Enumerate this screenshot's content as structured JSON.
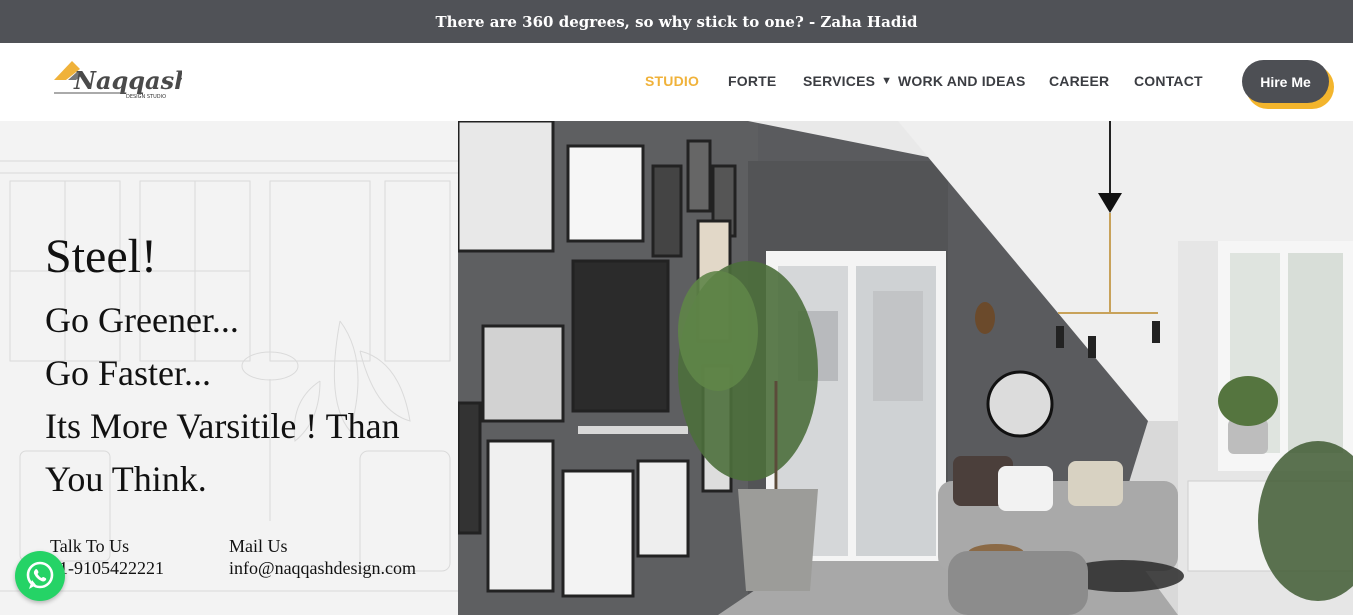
{
  "quote": "There are 360 degrees, so why stick to one? - Zaha Hadid",
  "brand": {
    "logo_text": "Naqqash",
    "logo_sub": "DESIGN STUDIO"
  },
  "nav": {
    "studio": "STUDIO",
    "forte": "FORTE",
    "services": "SERVICES",
    "work": "WORK AND IDEAS",
    "career": "CAREER",
    "contact": "CONTACT",
    "hire": "Hire Me"
  },
  "hero": {
    "line1": "Steel!",
    "line2": "Go Greener...",
    "line3": "Go Faster...",
    "line4": "Its More Varsitile ! Than",
    "line5": "You Think."
  },
  "contacts": {
    "talk_label": "Talk To Us",
    "talk_value": "91-9105422221",
    "mail_label": "Mail Us",
    "mail_value": "info@naqqashdesign.com"
  },
  "colors": {
    "accent": "#f0b23a",
    "dark": "#4d4f54",
    "whatsapp": "#25d366"
  },
  "icons": {
    "whatsapp": "whatsapp-icon",
    "caret": "caret-down-icon"
  }
}
